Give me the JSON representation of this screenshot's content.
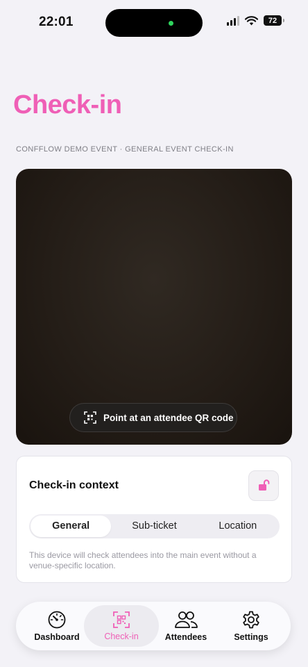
{
  "status_bar": {
    "time": "22:01",
    "battery": "72"
  },
  "page": {
    "title": "Check-in",
    "subtitle": "CONFFLOW DEMO EVENT · GENERAL EVENT CHECK-IN"
  },
  "scanner": {
    "hint": "Point at an attendee QR code"
  },
  "context": {
    "title": "Check-in context",
    "lock_icon": "unlock-icon",
    "segments": [
      "General",
      "Sub-ticket",
      "Location"
    ],
    "selected_segment": "General",
    "description": "This device will check attendees into the main event without a venue-specific location."
  },
  "tab_bar": {
    "tabs": [
      {
        "label": "Dashboard",
        "icon": "gauge-icon"
      },
      {
        "label": "Check-in",
        "icon": "qr-scan-icon"
      },
      {
        "label": "Attendees",
        "icon": "people-icon"
      },
      {
        "label": "Settings",
        "icon": "gear-icon"
      }
    ],
    "active": "Check-in"
  },
  "colors": {
    "accent": "#ef5fb6",
    "background": "#f3f2f7",
    "camera": "#221b15"
  }
}
